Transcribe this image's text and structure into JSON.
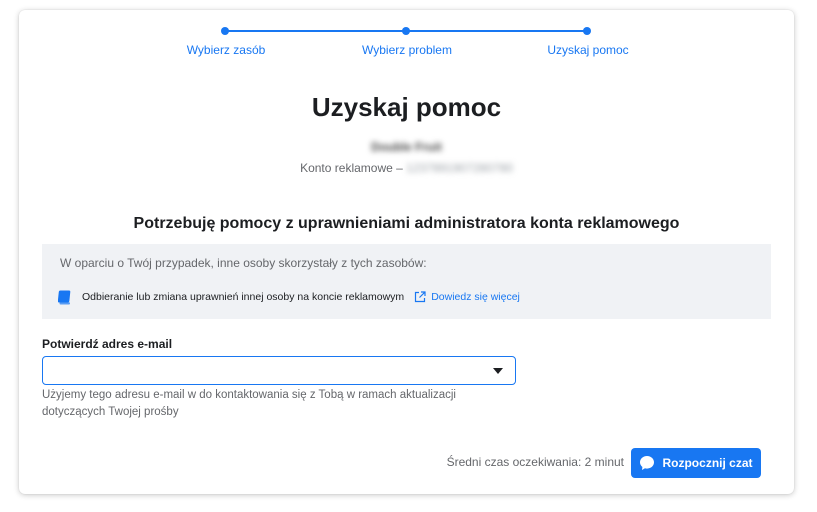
{
  "stepper": {
    "steps": [
      {
        "label": "Wybierz zasób"
      },
      {
        "label": "Wybierz problem"
      },
      {
        "label": "Uzyskaj pomoc"
      }
    ]
  },
  "page": {
    "title": "Uzyskaj pomoc",
    "account_name": "Double Fruit",
    "account_prefix": "Konto reklamowe – ",
    "account_id": "1237891907280780"
  },
  "section": {
    "title": "Potrzebuję pomocy z uprawnieniami administratora konta reklamowego"
  },
  "info": {
    "intro": "W oparciu o Twój przypadek, inne osoby skorzystały z tych zasobów:",
    "resource_label": "Odbieranie lub zmiana uprawnień innej osoby na koncie reklamowym",
    "learn_more": "Dowiedz się więcej",
    "resource_icon": "book-icon",
    "link_icon": "external-link-icon"
  },
  "email": {
    "label": "Potwierdź adres e-mail",
    "value": "",
    "help": "Użyjemy tego adresu e-mail w do kontaktowania się z Tobą w ramach aktualizacji dotyczących Twojej prośby"
  },
  "footer": {
    "wait_text": "Średni czas oczekiwania: 2 minut",
    "chat_button": "Rozpocznij czat",
    "chat_icon": "chat-bubble-icon"
  },
  "colors": {
    "accent": "#1877f2",
    "info_bg": "#f0f2f5",
    "text": "#1c1e21",
    "muted": "#65676b"
  }
}
